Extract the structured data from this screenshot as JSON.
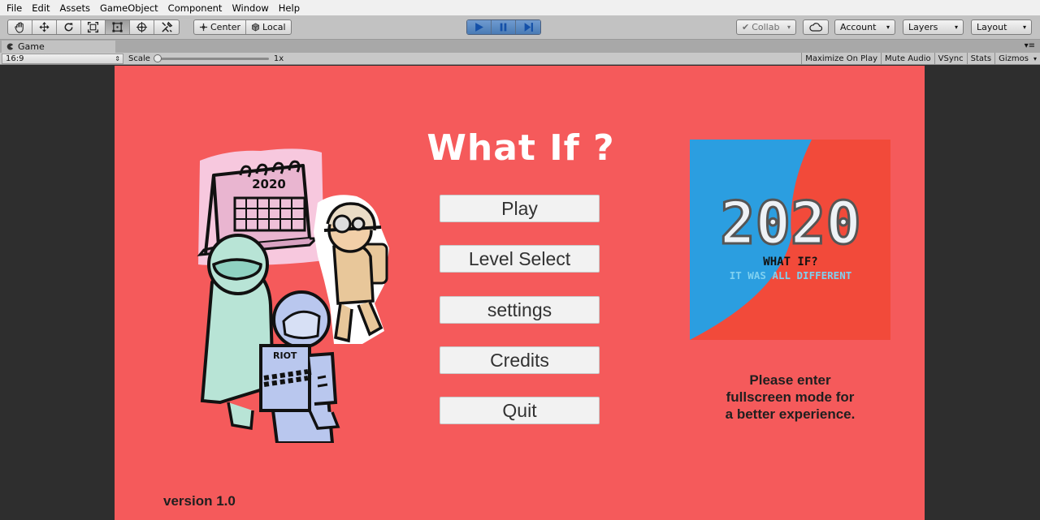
{
  "menu": [
    "File",
    "Edit",
    "Assets",
    "GameObject",
    "Component",
    "Window",
    "Help"
  ],
  "toolbar": {
    "tools": [
      "hand-icon",
      "move-icon",
      "rotate-icon",
      "scale-icon",
      "rect-icon",
      "transform-icon",
      "custom-tool-icon"
    ],
    "pivot": "Center",
    "space": "Local",
    "collab": "Collab",
    "account": "Account",
    "layers": "Layers",
    "layout": "Layout"
  },
  "tab": {
    "label": "Game"
  },
  "game_toolbar": {
    "aspect": "16:9",
    "scale_label": "Scale",
    "scale_value": "1x",
    "maximize": "Maximize On Play",
    "mute": "Mute Audio",
    "vsync": "VSync",
    "stats": "Stats",
    "gizmos": "Gizmos"
  },
  "game": {
    "title": "What If ?",
    "buttons": [
      "Play",
      "Level Select",
      "settings",
      "Credits",
      "Quit"
    ],
    "notice": [
      "Please enter",
      "fullscreen mode for",
      "a better experience."
    ],
    "version": "version 1.0",
    "colors": {
      "background": "#f55a5b",
      "title": "#ffffff"
    },
    "art": {
      "calendar_text": "2020",
      "sign_text": "RIOT"
    },
    "logo": {
      "year": "2020",
      "line1": "WHAT IF?",
      "line2": "IT WAS ALL DIFFERENT",
      "colors": {
        "left": "#2b9ee0",
        "right": "#f24a3a"
      }
    }
  }
}
